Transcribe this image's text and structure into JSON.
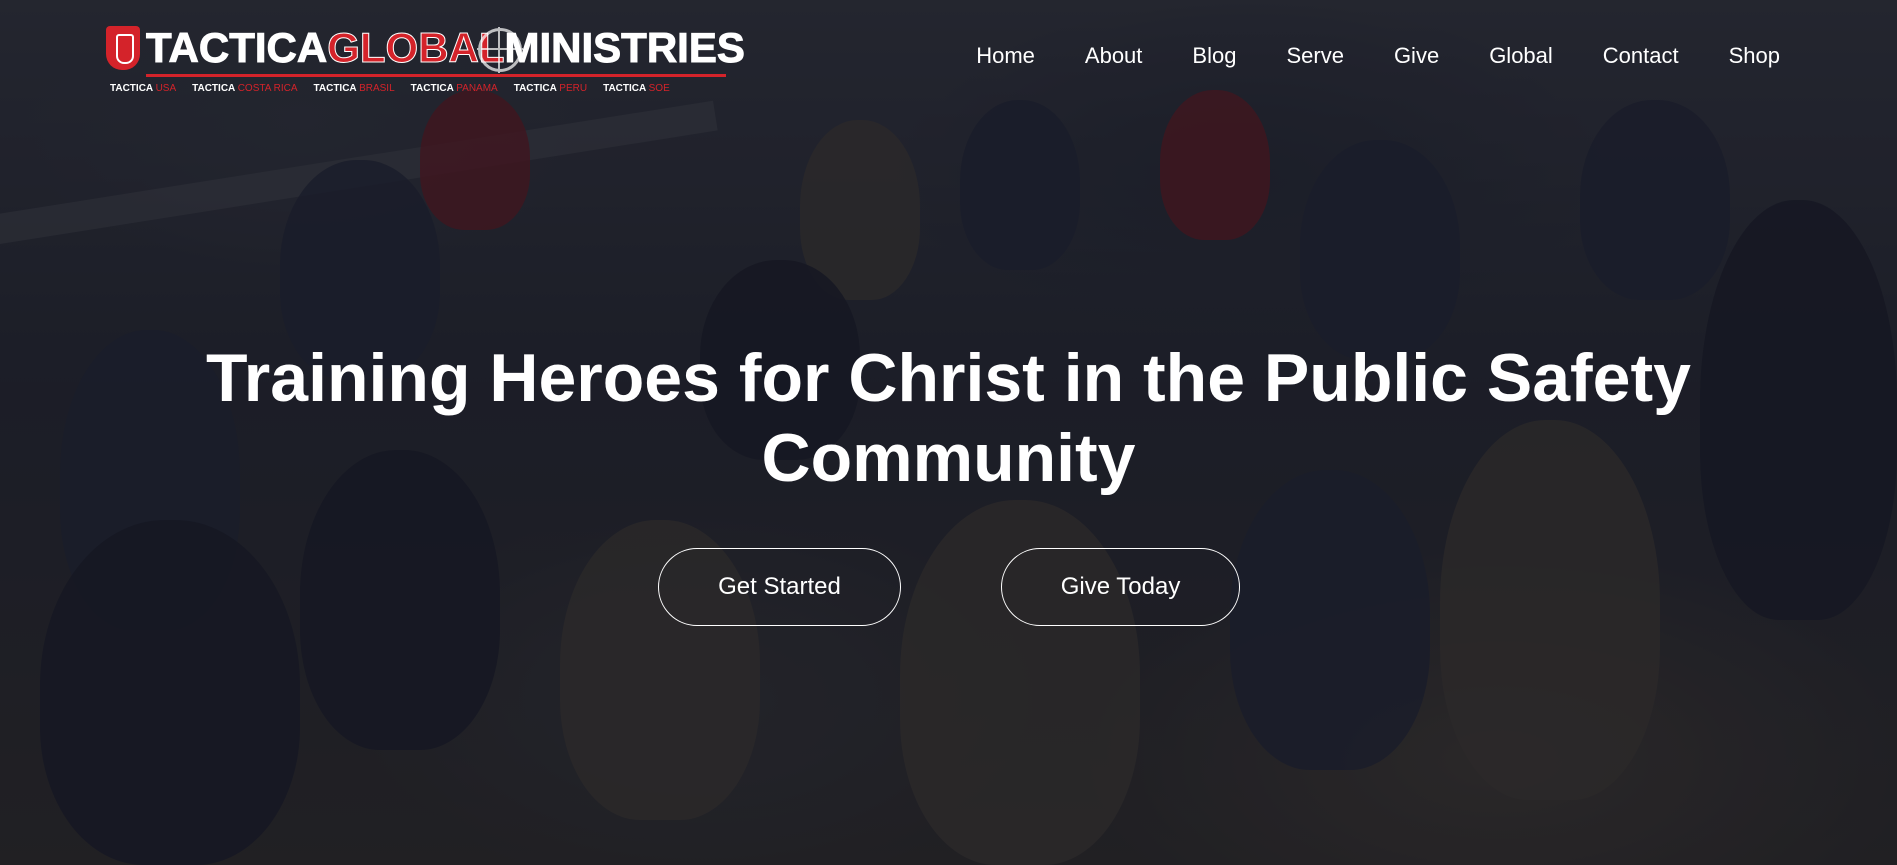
{
  "brand": {
    "logo_parts": [
      "TACTICA",
      "GL",
      "O",
      "BAL",
      "MINISTRIES"
    ],
    "sub_brands": [
      {
        "main": "TACTICA",
        "accent": "USA"
      },
      {
        "main": "TACTICA",
        "accent": "COSTA RICA"
      },
      {
        "main": "TACTICA",
        "accent": "BRASIL"
      },
      {
        "main": "TACTICA",
        "accent": "PANAMA"
      },
      {
        "main": "TACTICA",
        "accent": "PERU"
      },
      {
        "main": "TACTICA",
        "accent": "SOE"
      }
    ],
    "colors": {
      "accent": "#d4232a",
      "text": "#ffffff"
    }
  },
  "nav": {
    "items": [
      "Home",
      "About",
      "Blog",
      "Serve",
      "Give",
      "Global",
      "Contact",
      "Shop"
    ]
  },
  "hero": {
    "headline": "Training Heroes for Christ in the Public Safety Community",
    "buttons": {
      "get_started": "Get Started",
      "give_today": "Give Today"
    },
    "overlay_color": "#10121e"
  }
}
